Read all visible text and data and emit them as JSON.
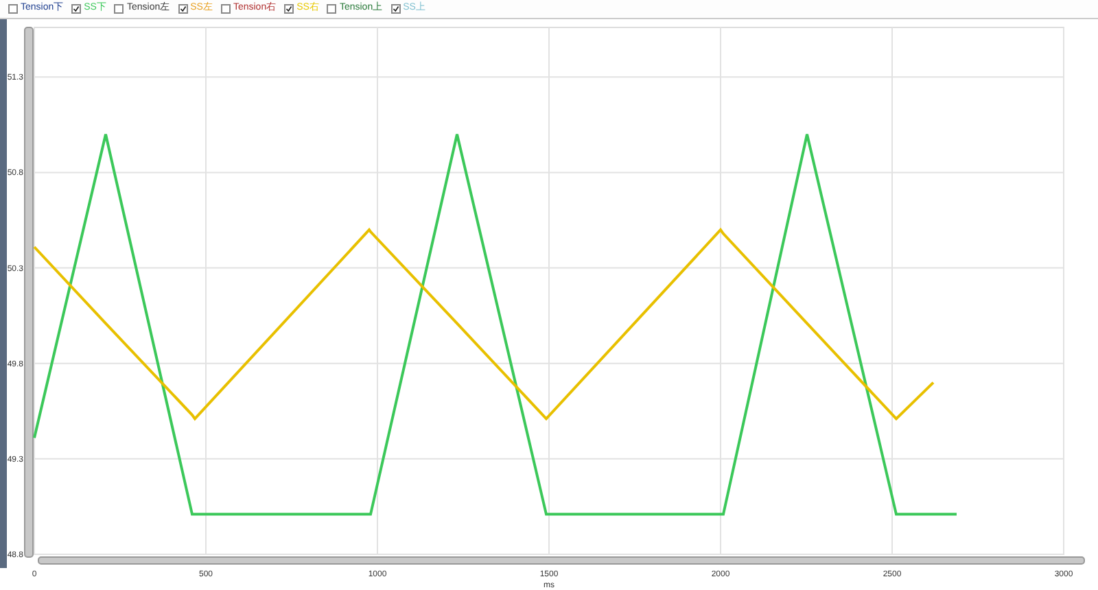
{
  "legend": [
    {
      "label": "Tension下",
      "checked": false,
      "color": "#1f3f8f"
    },
    {
      "label": "SS下",
      "checked": true,
      "color": "#3cc85a"
    },
    {
      "label": "Tension左",
      "checked": false,
      "color": "#3a3a3a"
    },
    {
      "label": "SS左",
      "checked": true,
      "color": "#e8a020"
    },
    {
      "label": "Tension右",
      "checked": false,
      "color": "#b03030"
    },
    {
      "label": "SS右",
      "checked": true,
      "color": "#e8c800"
    },
    {
      "label": "Tension上",
      "checked": false,
      "color": "#2a7a3a"
    },
    {
      "label": "SS上",
      "checked": true,
      "color": "#80c0d0"
    }
  ],
  "chart_data": {
    "type": "line",
    "grid": true,
    "xlabel": "ms",
    "xlim": [
      0,
      3000
    ],
    "ylim": [
      48.8,
      51.56
    ],
    "xticks": [
      0,
      500,
      1000,
      1500,
      2000,
      2500,
      3000
    ],
    "yticks": [
      48.8,
      49.3,
      49.8,
      50.3,
      50.8,
      51.3
    ],
    "x": [
      0,
      208,
      460,
      468,
      976,
      980,
      1232,
      1492,
      2000,
      2008,
      2252,
      2512,
      2620,
      2688
    ],
    "series": [
      {
        "color": "#3cc85a",
        "values": [
          49.41,
          51.0,
          49.01,
          49.01,
          49.01,
          49.01,
          51.0,
          49.01,
          49.01,
          49.01,
          51.0,
          49.01,
          49.01,
          49.01
        ]
      },
      {
        "color": "#e8c000",
        "values": [
          50.41,
          50.01,
          49.53,
          49.51,
          50.5,
          50.49,
          50.01,
          49.51,
          50.5,
          50.48,
          50.01,
          49.51,
          49.7,
          null
        ]
      }
    ]
  }
}
